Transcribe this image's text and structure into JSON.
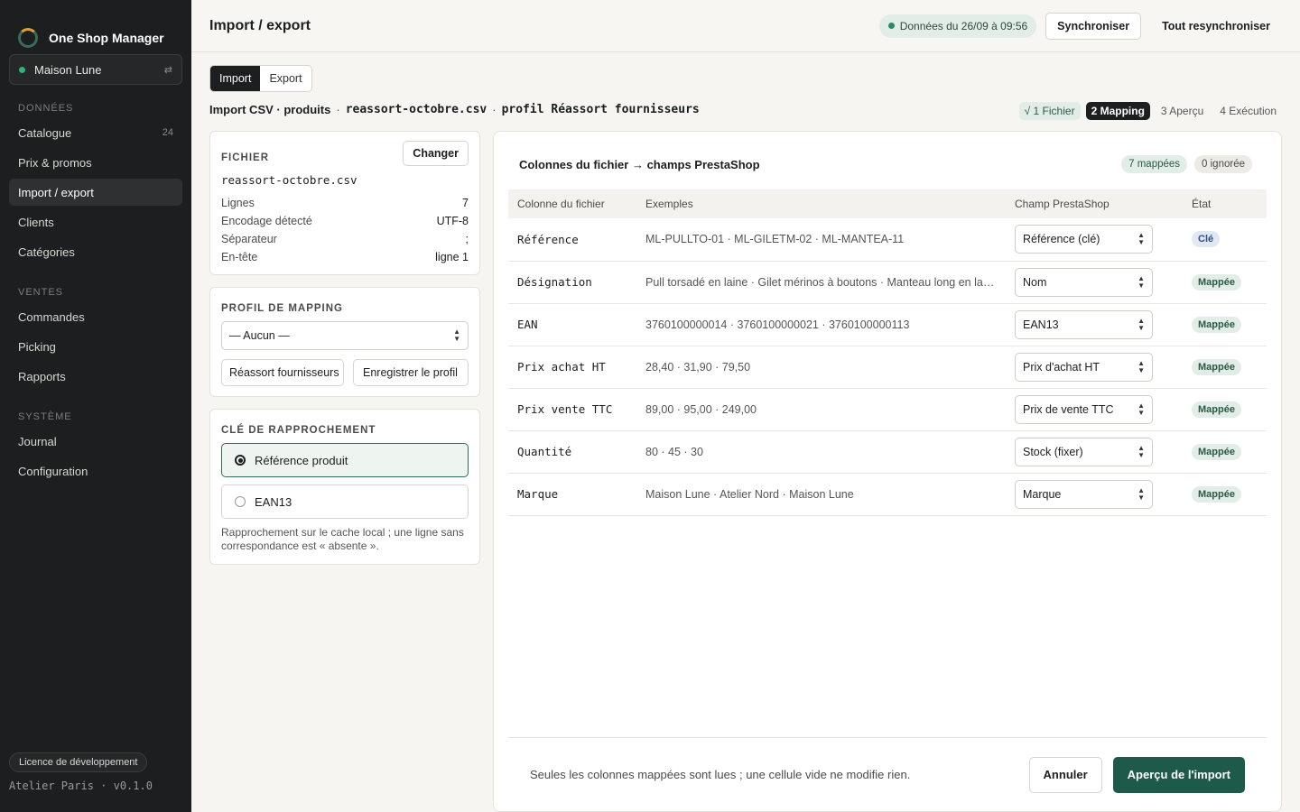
{
  "app": {
    "name": "One Shop Manager"
  },
  "shop": {
    "name": "Maison Lune",
    "switch_icon": "⇄"
  },
  "sidebar": {
    "sections": [
      {
        "label": "DONNÉES",
        "items": [
          {
            "label": "Catalogue",
            "count": "24"
          },
          {
            "label": "Prix & promos"
          },
          {
            "label": "Import / export",
            "active": true
          },
          {
            "label": "Clients"
          },
          {
            "label": "Catégories"
          }
        ]
      },
      {
        "label": "VENTES",
        "items": [
          {
            "label": "Commandes"
          },
          {
            "label": "Picking"
          },
          {
            "label": "Rapports"
          }
        ]
      },
      {
        "label": "SYSTÈME",
        "items": [
          {
            "label": "Journal"
          },
          {
            "label": "Configuration"
          }
        ]
      }
    ],
    "licence": "Licence de développement",
    "version": "Atelier Paris · v0.1.0"
  },
  "header": {
    "title": "Import / export",
    "sync_status": "Données du 26/09 à 09:56",
    "sync_button": "Synchroniser",
    "resync_button": "Tout resynchroniser"
  },
  "tabs": [
    "Import",
    "Export"
  ],
  "breadcrumb": {
    "type": "Import CSV · produits",
    "sep": "·",
    "file": "reassort-octobre.csv",
    "profile": "profil Réassort fournisseurs"
  },
  "steps": [
    {
      "label": "√ 1 Fichier",
      "state": "done"
    },
    {
      "label": "2 Mapping",
      "state": "current"
    },
    {
      "label": "3 Aperçu",
      "state": "todo"
    },
    {
      "label": "4 Exécution",
      "state": "todo"
    }
  ],
  "file_panel": {
    "label": "FICHIER",
    "change_button": "Changer",
    "filename": "reassort-octobre.csv",
    "rows": [
      {
        "k": "Lignes",
        "v": "7"
      },
      {
        "k": "Encodage détecté",
        "v": "UTF-8"
      },
      {
        "k": "Séparateur",
        "v": ";"
      },
      {
        "k": "En-tête",
        "v": "ligne 1"
      }
    ]
  },
  "profile_panel": {
    "label": "PROFIL DE MAPPING",
    "select_value": "— Aucun —",
    "saved_profile_button": "Réassort fournisseurs",
    "save_button": "Enregistrer le profil"
  },
  "key_panel": {
    "label": "CLÉ DE RAPPROCHEMENT",
    "options": [
      "Référence produit",
      "EAN13"
    ],
    "selected": 0,
    "help": "Rapprochement sur le cache local ; une ligne sans correspondance est « absente »."
  },
  "mapping": {
    "title": "Colonnes du fichier → champs PrestaShop",
    "mapped_chip": "7 mappées",
    "ignored_chip": "0 ignorée",
    "headers": [
      "Colonne du fichier",
      "Exemples",
      "Champ PrestaShop",
      "État"
    ],
    "rows": [
      {
        "col": "Référence",
        "ex": "ML-PULLTO-01 · ML-GILETM-02 · ML-MANTEA-11",
        "field": "Référence (clé)",
        "state": "Clé",
        "kind": "key"
      },
      {
        "col": "Désignation",
        "ex": "Pull torsadé en laine · Gilet mérinos à boutons · Manteau long en laine",
        "field": "Nom",
        "state": "Mappée",
        "kind": "mapped"
      },
      {
        "col": "EAN",
        "ex": "3760100000014 · 3760100000021 · 3760100000113",
        "field": "EAN13",
        "state": "Mappée",
        "kind": "mapped"
      },
      {
        "col": "Prix achat HT",
        "ex": "28,40 · 31,90 · 79,50",
        "field": "Prix d'achat HT",
        "state": "Mappée",
        "kind": "mapped"
      },
      {
        "col": "Prix vente TTC",
        "ex": "89,00 · 95,00 · 249,00",
        "field": "Prix de vente TTC",
        "state": "Mappée",
        "kind": "mapped"
      },
      {
        "col": "Quantité",
        "ex": "80 · 45 · 30",
        "field": "Stock (fixer)",
        "state": "Mappée",
        "kind": "mapped"
      },
      {
        "col": "Marque",
        "ex": "Maison Lune · Atelier Nord · Maison Lune",
        "field": "Marque",
        "state": "Mappée",
        "kind": "mapped"
      }
    ],
    "footer_note": "Seules les colonnes mappées sont lues ; une cellule vide ne modifie rien.",
    "cancel_button": "Annuler",
    "preview_button": "Aperçu de l'import"
  }
}
